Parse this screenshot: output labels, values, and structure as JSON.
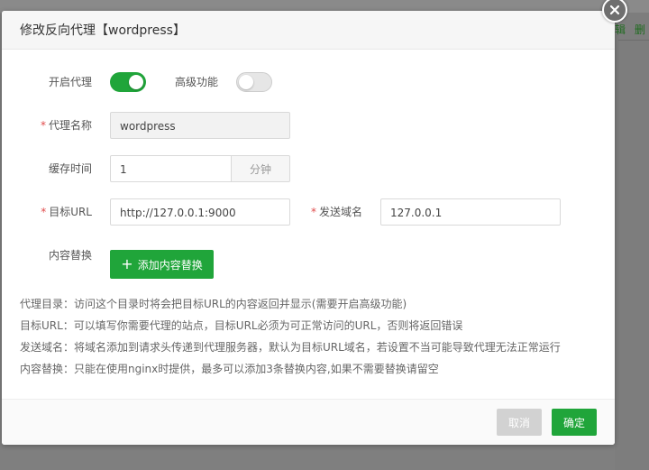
{
  "background": {
    "links": [
      "辑",
      "删"
    ]
  },
  "dialog": {
    "title": "修改反向代理【wordpress】",
    "form": {
      "enable_proxy_label": "开启代理",
      "enable_proxy_on": true,
      "advanced_label": "高级功能",
      "advanced_on": false,
      "proxy_name_label": "代理名称",
      "proxy_name_value": "wordpress",
      "cache_time_label": "缓存时间",
      "cache_time_value": "1",
      "cache_time_unit": "分钟",
      "target_url_label": "目标URL",
      "target_url_value": "http://127.0.0.1:9000",
      "send_domain_label": "发送域名",
      "send_domain_value": "127.0.0.1",
      "content_replace_label": "内容替换",
      "add_replace_button": "添加内容替换",
      "required_mark": "*"
    },
    "help_lines": [
      "代理目录：访问这个目录时将会把目标URL的内容返回并显示(需要开启高级功能)",
      "目标URL：可以填写你需要代理的站点，目标URL必须为可正常访问的URL，否则将返回错误",
      "发送域名：将域名添加到请求头传递到代理服务器，默认为目标URL域名，若设置不当可能导致代理无法正常运行",
      "内容替换：只能在使用nginx时提供，最多可以添加3条替换内容,如果不需要替换请留空"
    ],
    "footer": {
      "cancel_label": "取消",
      "confirm_label": "确定"
    }
  },
  "colors": {
    "accent": "#20a53a",
    "required": "#e04a4a"
  }
}
